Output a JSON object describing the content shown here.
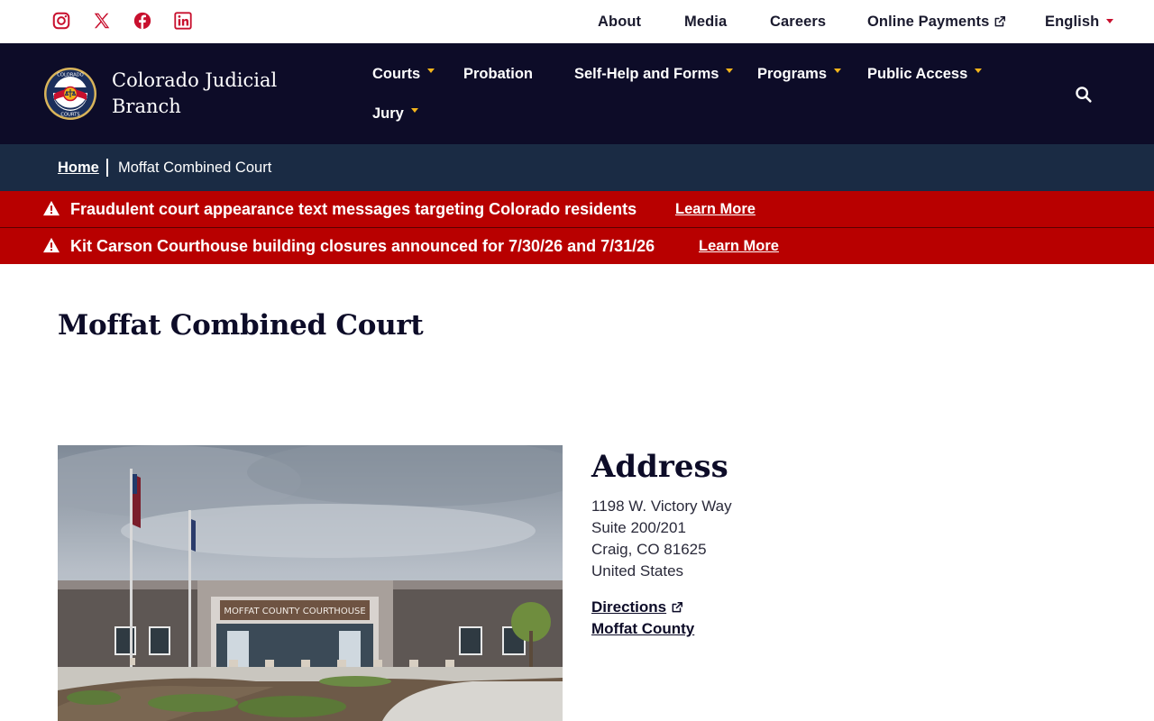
{
  "utility": {
    "social": [
      {
        "name": "instagram-icon"
      },
      {
        "name": "x-icon"
      },
      {
        "name": "facebook-icon"
      },
      {
        "name": "linkedin-icon"
      }
    ],
    "links": {
      "about": "About",
      "media": "Media",
      "careers": "Careers",
      "online_payments": "Online Payments",
      "language": "English"
    }
  },
  "nav": {
    "site_title_line1": "Colorado Judicial",
    "site_title_line2": "Branch",
    "items": {
      "courts": "Courts",
      "probation": "Probation",
      "self_help": "Self-Help and Forms",
      "programs": "Programs",
      "public_access": "Public Access",
      "jury": "Jury"
    },
    "seal_text_top": "COLORADO",
    "seal_text_bottom": "COURTS"
  },
  "breadcrumb": {
    "home": "Home",
    "current": "Moffat Combined Court"
  },
  "alerts": [
    {
      "text": "Fraudulent court appearance text messages targeting Colorado residents",
      "link": "Learn More"
    },
    {
      "text": "Kit Carson Courthouse building closures announced for 7/30/26 and 7/31/26",
      "link": "Learn More"
    }
  ],
  "page": {
    "title": "Moffat Combined Court",
    "photo_sign": "MOFFAT COUNTY COURTHOUSE",
    "address_heading": "Address",
    "address_lines": [
      "1198 W. Victory Way",
      "Suite 200/201",
      "Craig, CO 81625",
      "United States"
    ],
    "directions": "Directions",
    "county": "Moffat County"
  },
  "colors": {
    "nav_bg": "#0d0c28",
    "breadcrumb_bg": "#1a2b44",
    "alert_bg": "#b80000",
    "accent_gold": "#f2b41b",
    "social_red": "#c8102e"
  }
}
